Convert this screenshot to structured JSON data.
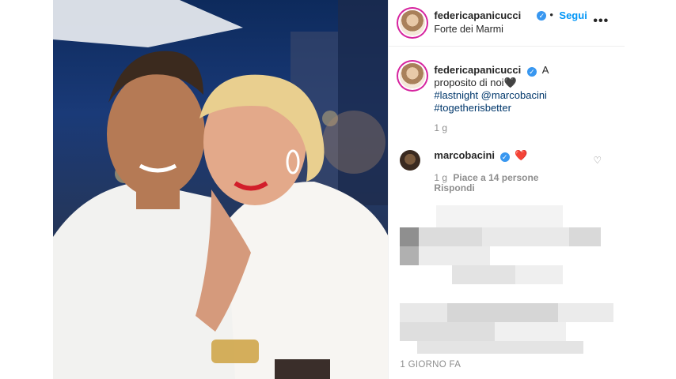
{
  "post": {
    "author": "federicapanicucci",
    "follow_label": "Segui",
    "location": "Forte dei Marmi",
    "more_label": "•••",
    "caption_text": "A proposito di noi🖤",
    "hashtags": [
      "#lastnight @marcobacini",
      "#togetherisbetter"
    ],
    "caption_time": "1 g",
    "time_ago": "1 GIORNO FA"
  },
  "comment": {
    "author": "marcobacini",
    "text": "❤️",
    "time": "1 g",
    "likes": "Piace a 14 persone",
    "reply_label": "Rispondi"
  },
  "icons": {
    "verified": "✓",
    "heart": "♡",
    "dot": "•"
  },
  "colors": {
    "link": "#0095f6",
    "hashtag": "#00376b",
    "verified": "#3897f0"
  }
}
